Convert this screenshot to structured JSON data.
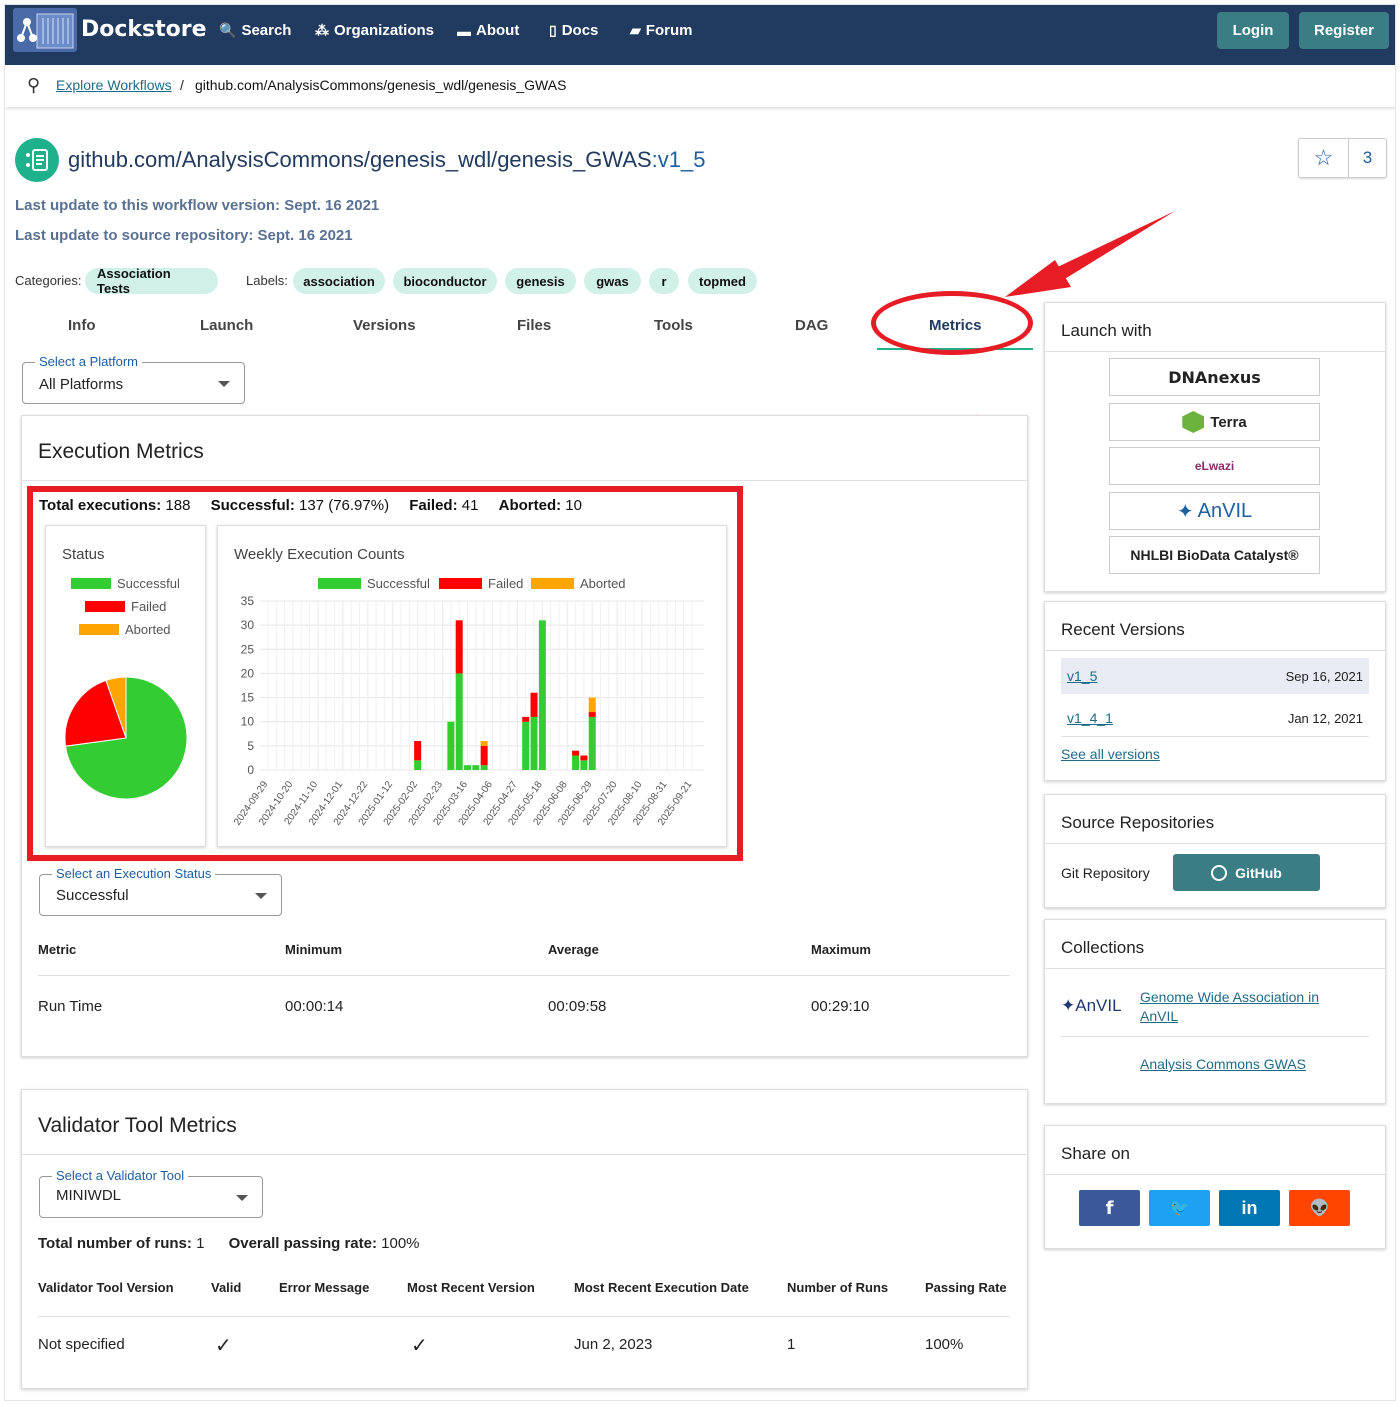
{
  "nav": {
    "brand": "Dockstore",
    "items": [
      {
        "icon": "search-icon",
        "label": "Search"
      },
      {
        "icon": "organizations-icon",
        "label": "Organizations"
      },
      {
        "icon": "about-icon",
        "label": "About"
      },
      {
        "icon": "docs-icon",
        "label": "Docs"
      },
      {
        "icon": "forum-icon",
        "label": "Forum"
      }
    ],
    "login": "Login",
    "register": "Register"
  },
  "breadcrumb": {
    "link": "Explore Workflows",
    "sep": "/",
    "current": "github.com/AnalysisCommons/genesis_wdl/genesis_GWAS"
  },
  "workflow": {
    "path": "github.com/AnalysisCommons/genesis_wdl/genesis_GWAS",
    "version": ":v1_5",
    "last_update_version": "Last update to this workflow version: Sept. 16 2021",
    "last_update_repo": "Last update to source repository: Sept. 16 2021",
    "stars": "3"
  },
  "categories": {
    "label": "Categories:",
    "items": [
      "Association Tests"
    ]
  },
  "labels": {
    "label": "Labels:",
    "items": [
      "association",
      "bioconductor",
      "genesis",
      "gwas",
      "r",
      "topmed"
    ]
  },
  "tabs": [
    "Info",
    "Launch",
    "Versions",
    "Files",
    "Tools",
    "DAG",
    "Metrics"
  ],
  "platform_select": {
    "label": "Select a Platform",
    "value": "All Platforms"
  },
  "execution": {
    "title": "Execution Metrics",
    "total_label": "Total executions:",
    "total": "188",
    "success_label": "Successful:",
    "success": "137 (76.97%)",
    "failed_label": "Failed:",
    "failed": "41",
    "aborted_label": "Aborted:",
    "aborted": "10",
    "status_title": "Status",
    "weekly_title": "Weekly Execution Counts",
    "legend": [
      "Successful",
      "Failed",
      "Aborted"
    ],
    "status_select": {
      "label": "Select an Execution Status",
      "value": "Successful"
    },
    "table_headers": [
      "Metric",
      "Minimum",
      "Average",
      "Maximum"
    ],
    "table_row": [
      "Run Time",
      "00:00:14",
      "00:09:58",
      "00:29:10"
    ]
  },
  "colors": {
    "successful": "#33cc33",
    "failed": "#ff0000",
    "aborted": "#ffa500",
    "navbar": "#213a60",
    "teal": "#3b7d84",
    "annotation": "#e81c24"
  },
  "chart_data": [
    {
      "type": "pie",
      "title": "Status",
      "categories": [
        "Successful",
        "Failed",
        "Aborted"
      ],
      "values": [
        137,
        41,
        10
      ],
      "legend_position": "top"
    },
    {
      "type": "bar",
      "stacked": true,
      "title": "Weekly Execution Counts",
      "ylim": [
        0,
        35
      ],
      "yticks": [
        0,
        5,
        10,
        15,
        20,
        25,
        30,
        35
      ],
      "x_tick_labels": [
        "2024-09-29",
        "2024-10-20",
        "2024-11-10",
        "2024-12-01",
        "2024-12-22",
        "2025-01-12",
        "2025-02-02",
        "2025-02-23",
        "2025-03-16",
        "2025-04-06",
        "2025-04-27",
        "2025-05-18",
        "2025-06-08",
        "2025-06-29",
        "2025-07-20",
        "2025-08-10",
        "2025-08-31",
        "2025-09-21"
      ],
      "categories": [
        "2025-02-02",
        "2025-02-16",
        "2025-03-02",
        "2025-03-09",
        "2025-03-16",
        "2025-03-23",
        "2025-03-30",
        "2025-05-04",
        "2025-05-11",
        "2025-05-18",
        "2025-06-15",
        "2025-06-22",
        "2025-06-29"
      ],
      "series": [
        {
          "name": "Successful",
          "values": [
            2,
            0,
            10,
            20,
            1,
            1,
            1,
            10,
            11,
            31,
            3,
            2,
            11
          ]
        },
        {
          "name": "Failed",
          "values": [
            4,
            0,
            0,
            11,
            0,
            0,
            4,
            1,
            5,
            0,
            1,
            1,
            1
          ]
        },
        {
          "name": "Aborted",
          "values": [
            0,
            0,
            0,
            0,
            0,
            0,
            1,
            0,
            0,
            0,
            0,
            0,
            3
          ]
        }
      ],
      "legend_position": "top",
      "grid": true
    }
  ],
  "validator": {
    "title": "Validator Tool Metrics",
    "select": {
      "label": "Select a Validator Tool",
      "value": "MINIWDL"
    },
    "runs_label": "Total number of runs:",
    "runs": "1",
    "rate_label": "Overall passing rate:",
    "rate": "100%",
    "headers": [
      "Validator Tool Version",
      "Valid",
      "Error Message",
      "Most Recent Version",
      "Most Recent Execution Date",
      "Number of Runs",
      "Passing Rate"
    ],
    "row": {
      "version": "Not specified",
      "valid": "✓",
      "error": "",
      "recent": "✓",
      "date": "Jun 2, 2023",
      "runs": "1",
      "rate": "100%"
    }
  },
  "sidebar": {
    "launch_title": "Launch with",
    "launch": [
      "DNAnexus",
      "Terra",
      "eLwazi",
      "AnVIL",
      "NHLBI BioData Catalyst®"
    ],
    "recent_title": "Recent Versions",
    "versions": [
      {
        "name": "v1_5",
        "date": "Sep 16, 2021"
      },
      {
        "name": "v1_4_1",
        "date": "Jan 12, 2021"
      }
    ],
    "see_all": "See all versions",
    "source_title": "Source Repositories",
    "git_label": "Git Repository",
    "github": "GitHub",
    "collections_title": "Collections",
    "collections_org": "AnVIL",
    "collections": [
      "Genome Wide Association in AnVIL",
      "Analysis Commons GWAS"
    ],
    "share_title": "Share on",
    "share": [
      {
        "icon": "facebook-icon",
        "glyph": "f",
        "color": "#3b5998"
      },
      {
        "icon": "twitter-icon",
        "glyph": "🐦",
        "color": "#1da1f2"
      },
      {
        "icon": "linkedin-icon",
        "glyph": "in",
        "color": "#0077b5"
      },
      {
        "icon": "reddit-icon",
        "glyph": "👽",
        "color": "#ff4500"
      }
    ]
  }
}
